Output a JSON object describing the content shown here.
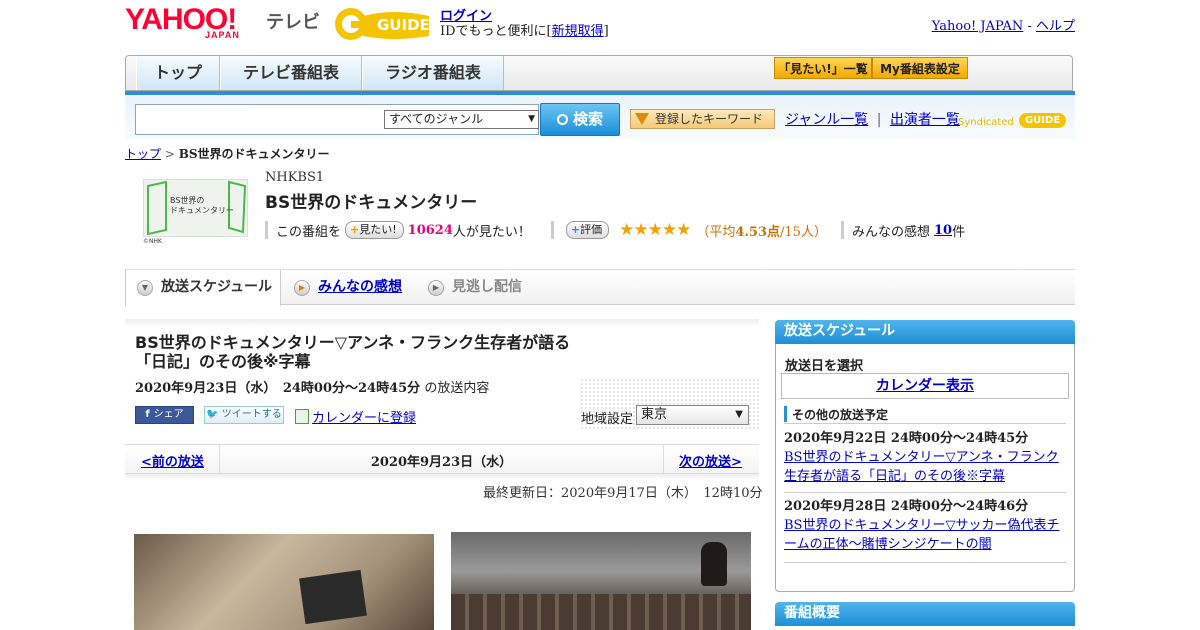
{
  "header": {
    "yahoo_logo": "YAHOO!",
    "yahoo_japan": "JAPAN",
    "tv_label": "テレビ",
    "gguide_logo": "GUIDE",
    "login_link": "ログイン",
    "id_prefix": "IDでもっと便利に[",
    "signup_link": "新規取得",
    "id_suffix": "]",
    "yahoo_japan_link": "Yahoo! JAPAN",
    "dash": " - ",
    "help_link": "ヘルプ"
  },
  "nav": {
    "tabs": [
      "トップ",
      "テレビ番組表",
      "ラジオ番組表"
    ],
    "mitai_list_button": "「見たい!」一覧",
    "my_schedule_button": "My番組表設定"
  },
  "search": {
    "input_value": "",
    "genre_selected": "すべてのジャンル",
    "search_button": "検索",
    "keyword_button": "登録したキーワード",
    "genre_list_link": "ジャンル一覧",
    "divider": "|",
    "cast_list_link": "出演者一覧",
    "syndicated": "Syndicated"
  },
  "breadcrumb": {
    "top_link": "トップ",
    "sep": " > ",
    "current": "BS世界のドキュメンタリー"
  },
  "program": {
    "thumb_text": "BS世界の\nドキュメンタリー",
    "thumb_credit": "©NHK",
    "channel": "NHKBS1",
    "title": "BS世界のドキュメンタリー",
    "mitai_prefix": "この番組を",
    "mitai_button": "見たい!",
    "mitai_count": "10624",
    "mitai_suffix": "人が見たい！",
    "rating_button": "評価",
    "stars": "★★★★★",
    "rating_open": "（平均",
    "rating_avg": "4.53点",
    "rating_count": "/15人）",
    "impressions_prefix": "みんなの感想",
    "impressions_count": "10",
    "impressions_suffix": "件"
  },
  "tabs": {
    "schedule": "放送スケジュール",
    "impressions": "みんなの感想",
    "missed": "見逃し配信"
  },
  "episode": {
    "title_line1": "BS世界のドキュメンタリー▽アンネ・フランク生存者が語る",
    "title_line2": "「日記」のその後※字幕",
    "airtime": "2020年9月23日（水）　24時00分～24時45分",
    "airtime_suffix": "の放送内容",
    "share_fb": "シェア",
    "share_tw": "ツイートする",
    "calendar_register": "カレンダーに登録",
    "region_label": "地域設定",
    "region_selected": "東京",
    "prev_link": "<前の放送",
    "current_date": "2020年9月23日（水）",
    "next_link": "次の放送>",
    "last_updated": "最終更新日：2020年9月17日（木）　12時10分"
  },
  "sidebar": {
    "schedule_header": "放送スケジュール",
    "select_date_label": "放送日を選択",
    "calendar_button": "カレンダー表示",
    "other_schedule": "その他の放送予定",
    "items": [
      {
        "datetime": "2020年9月22日  24時00分～24時45分",
        "title": "BS世界のドキュメンタリー▽アンネ・フランク生存者が語る「日記」のその後※字幕"
      },
      {
        "datetime": "2020年9月28日  24時00分～24時46分",
        "title": "BS世界のドキュメンタリー▽サッカー偽代表チームの正体～賭博シンジケートの闇"
      }
    ],
    "overview_header": "番組概要"
  }
}
